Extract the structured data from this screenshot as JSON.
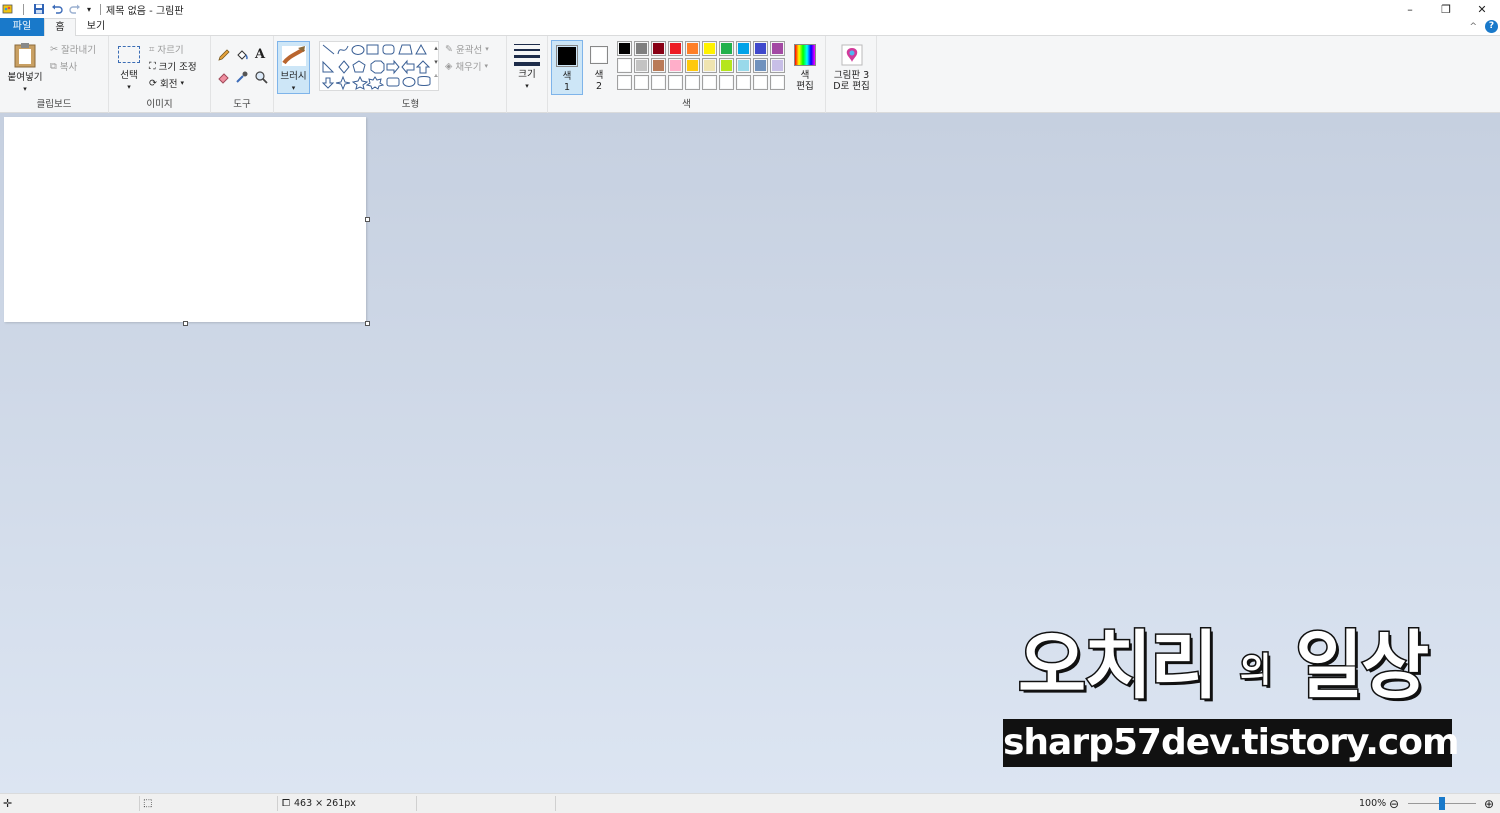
{
  "titlebar": {
    "title": "제목 없음 - 그림판",
    "minimize": "–",
    "restore": "❐",
    "close": "✕"
  },
  "tabs": {
    "file": "파일",
    "home": "홈",
    "view": "보기"
  },
  "ribbon": {
    "clipboard": {
      "paste": "붙여넣기",
      "cut": "잘라내기",
      "copy": "복사",
      "group": "클립보드"
    },
    "image": {
      "select": "선택",
      "crop": "자르기",
      "resize": "크기 조정",
      "rotate": "회전",
      "group": "이미지"
    },
    "tools": {
      "group": "도구",
      "text_glyph": "A"
    },
    "brushes": {
      "label": "브러시"
    },
    "shapes": {
      "outline": "윤곽선",
      "fill": "채우기",
      "group": "도형"
    },
    "size": {
      "label": "크기"
    },
    "colors": {
      "color1": "색\n1",
      "color1_a": "색",
      "color1_b": "1",
      "color2_a": "색",
      "color2_b": "2",
      "edit_a": "색",
      "edit_b": "편집",
      "group": "색",
      "color1_value": "#000000",
      "color2_value": "#ffffff",
      "palette_row1": [
        "#000000",
        "#7f7f7f",
        "#880015",
        "#ed1c24",
        "#ff7f27",
        "#fff200",
        "#22b14c",
        "#00a2e8",
        "#3f48cc",
        "#a349a4"
      ],
      "palette_row2": [
        "#ffffff",
        "#c3c3c3",
        "#b97a57",
        "#ffaec9",
        "#ffc90e",
        "#efe4b0",
        "#b5e61d",
        "#99d9ea",
        "#7092be",
        "#c8bfe7"
      ],
      "palette_row3": [
        "",
        "",
        "",
        "",
        "",
        "",
        "",
        "",
        "",
        ""
      ]
    },
    "paint3d": {
      "line1": "그림판 3",
      "line2": "D로 편집"
    }
  },
  "watermark": {
    "title_a": "오치리",
    "title_small": "의",
    "title_b": "일상",
    "url": "sharp57dev.tistory.com"
  },
  "statusbar": {
    "canvas_size": "463 × 261px",
    "zoom": "100%"
  }
}
